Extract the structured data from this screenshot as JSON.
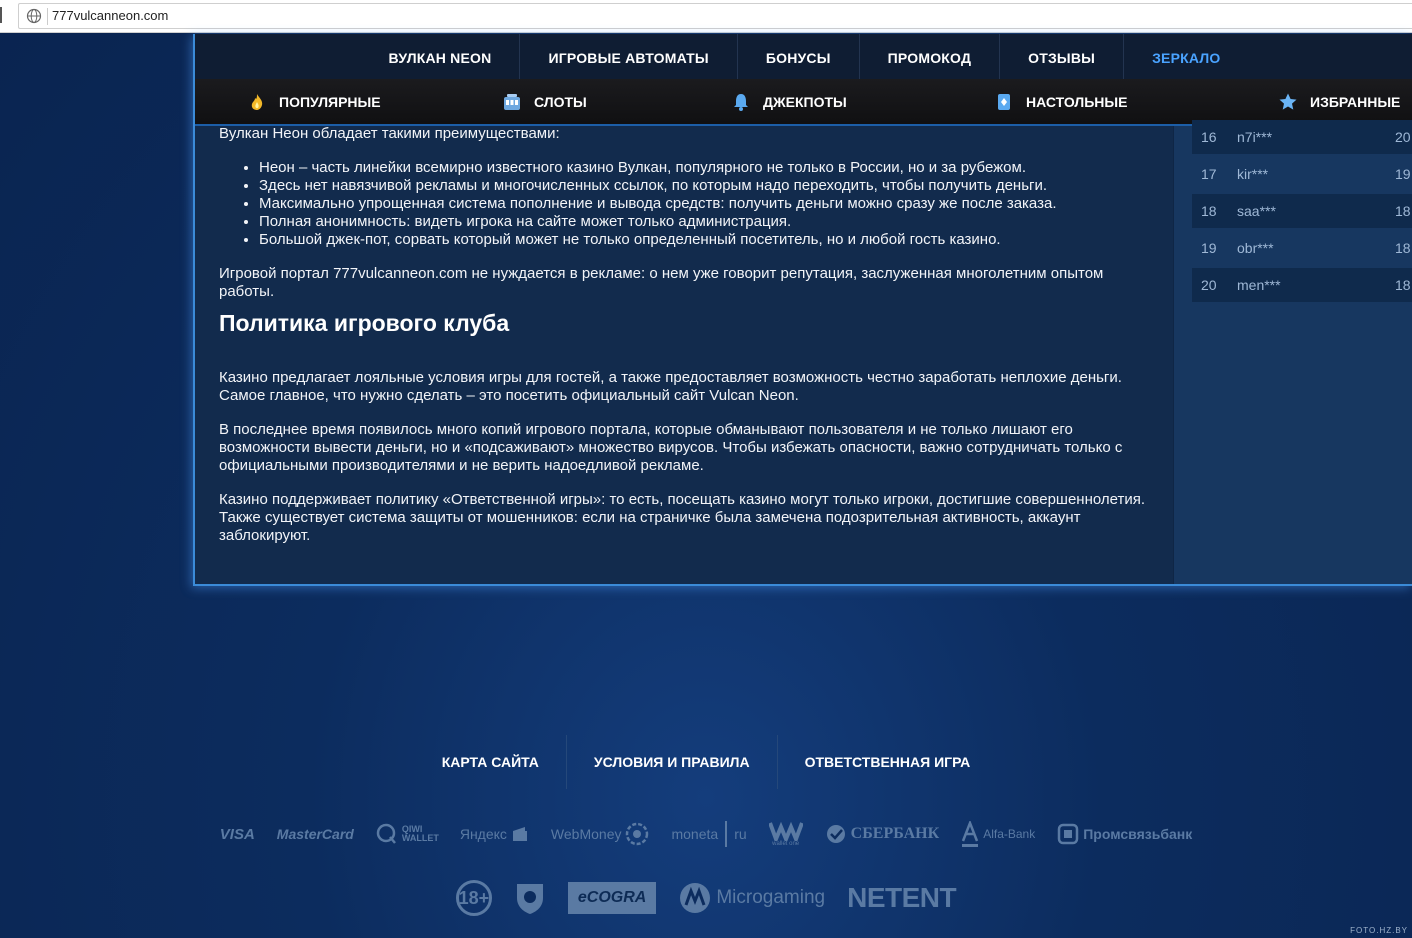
{
  "browser": {
    "url": "777vulcanneon.com"
  },
  "top_nav": [
    {
      "label": "ВУЛКАН NEON",
      "active": false
    },
    {
      "label": "ИГРОВЫЕ АВТОМАТЫ",
      "active": false
    },
    {
      "label": "БОНУСЫ",
      "active": false
    },
    {
      "label": "ПРОМОКОД",
      "active": false
    },
    {
      "label": "ОТЗЫВЫ",
      "active": false
    },
    {
      "label": "ЗЕРКАЛО",
      "active": true
    }
  ],
  "category_nav": [
    {
      "label": "ПОПУЛЯРНЫЕ",
      "icon": "flame-icon"
    },
    {
      "label": "СЛОТЫ",
      "icon": "slot-machine-icon"
    },
    {
      "label": "ДЖЕКПОТЫ",
      "icon": "bell-icon"
    },
    {
      "label": "НАСТОЛЬНЫЕ",
      "icon": "card-icon"
    },
    {
      "label": "ИЗБРАННЫЕ",
      "icon": "star-icon"
    }
  ],
  "content": {
    "lead": "Вулкан Неон обладает такими преимуществами:",
    "bullets": [
      "Неон – часть линейки всемирно известного казино Вулкан, популярного не только в России, но и за рубежом.",
      "Здесь нет навязчивой рекламы и многочисленных ссылок, по которым надо переходить, чтобы получить деньги.",
      "Максимально упрощенная система пополнение и вывода средств: получить деньги можно сразу же после заказа.",
      "Полная анонимность: видеть игрока на сайте может только администрация.",
      "Большой джек-пот, сорвать который может не только определенный посетитель, но и любой гость казино."
    ],
    "paragraph1": "Игровой портал 777vulcanneon.com не нуждается в рекламе: о нем уже говорит репутация, заслуженная многолетним опытом работы.",
    "heading": "Политика игрового клуба",
    "paragraph2": "Казино предлагает лояльные условия игры для гостей, а также предоставляет возможность честно заработать неплохие деньги. Самое главное, что нужно сделать – это посетить официальный сайт Vulcan Neon.",
    "paragraph3": "В последнее время появилось много копий игрового портала, которые обманывают пользователя и не только лишают его возможности вывести деньги, но и «подсаживают» множество вирусов. Чтобы избежать опасности, важно сотрудничать только с официальными производителями и не верить надоедливой рекламе.",
    "paragraph4": "Казино поддерживает политику «Ответственной игры»: то есть, посещать казино могут только игроки, достигшие совершеннолетия. Также существует система защиты от мошенников: если на страничке была замечена подозрительная активность, аккаунт заблокируют."
  },
  "winners": [
    {
      "num": "16",
      "name": "n7i***",
      "amount": "20"
    },
    {
      "num": "17",
      "name": "kir***",
      "amount": "19"
    },
    {
      "num": "18",
      "name": "saa***",
      "amount": "18"
    },
    {
      "num": "19",
      "name": "obr***",
      "amount": "18"
    },
    {
      "num": "20",
      "name": "men***",
      "amount": "18"
    }
  ],
  "footer": {
    "links": [
      "КАРТА САЙТА",
      "УСЛОВИЯ И ПРАВИЛА",
      "ОТВЕТСТВЕННАЯ ИГРА"
    ],
    "payments": {
      "visa": "VISA",
      "mastercard": "MasterCard",
      "qiwi": "QIWI WALLET",
      "yandex": "Яндекс",
      "webmoney": "WebMoney",
      "moneta": "moneta",
      "moneta_ru": "ru",
      "walletone": "wallet one",
      "sberbank": "СБЕРБАНК",
      "alfabank": "Alfa-Bank",
      "promsvyaz": "Промсвязьбанк"
    },
    "certs": {
      "age": "18+",
      "ecogra": "eCOGRA",
      "microgaming": "Microgaming",
      "netent": "NETENT"
    }
  },
  "watermark": "FOTO.HZ.BY",
  "colors": {
    "accent": "#4aa3ff",
    "border_glow": "#3b8bd8",
    "content_bg": "#122b4d",
    "footer_logo": "#5a7aa3"
  }
}
